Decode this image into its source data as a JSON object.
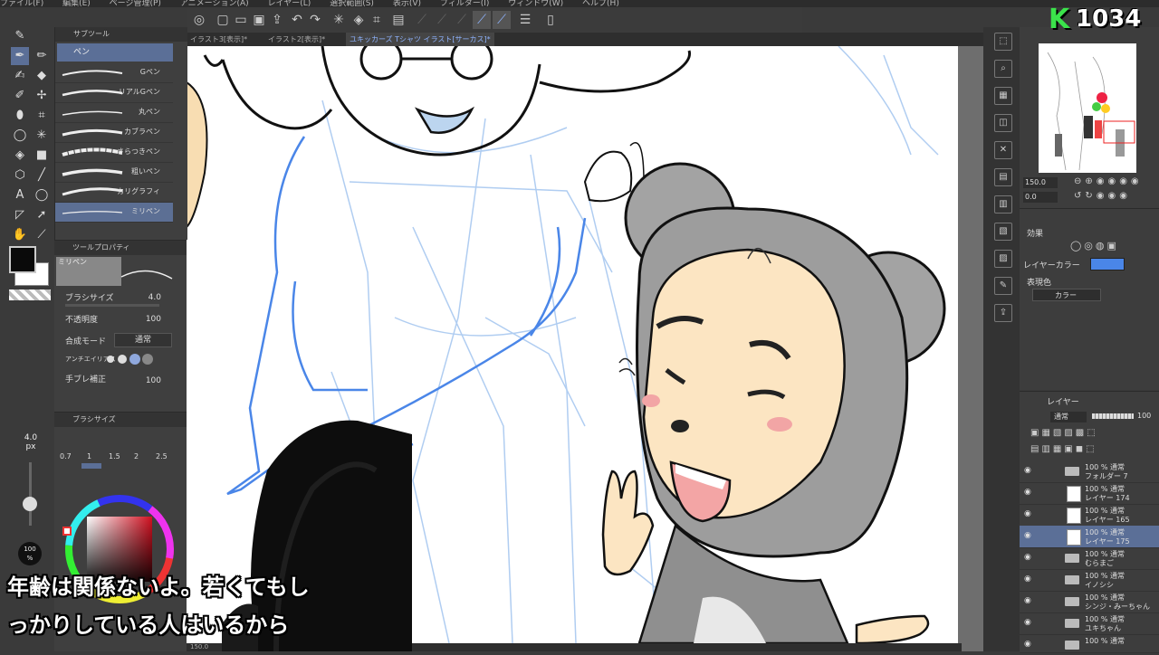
{
  "menubar": {
    "items": [
      "ファイル(F)",
      "編集(E)",
      "ページ管理(P)",
      "アニメーション(A)",
      "レイヤー(L)",
      "選択範囲(S)",
      "表示(V)",
      "フィルター(I)",
      "ウィンドウ(W)",
      "ヘルプ(H)"
    ]
  },
  "tabs": [
    {
      "label": "イラスト3[表示]*"
    },
    {
      "label": "イラスト2[表示]*"
    },
    {
      "label": "ユキッカーズ Tシャツ イラスト[サーカス]*"
    }
  ],
  "subtool": {
    "title": "サブツール",
    "group": "ペン",
    "brushes": [
      "Gペン",
      "リアルGペン",
      "丸ペン",
      "カブラペン",
      "さらつきペン",
      "粗いペン",
      "カリグラフィ",
      "ミリペン"
    ]
  },
  "toolprop": {
    "title": "ツールプロパティ",
    "preview_label": "ミリペン",
    "brush_size_label": "ブラシサイズ",
    "brush_size_value": "4.0",
    "opacity_label": "不透明度",
    "opacity_value": "100",
    "blend_label": "合成モード",
    "blend_value": "通常",
    "antialias_label": "アンチエイリアス",
    "stabilize_label": "手ブレ補正",
    "stabilize_value": "100"
  },
  "brushsize": {
    "title": "ブラシサイズ",
    "values": [
      "0.7",
      "1",
      "1.5",
      "2",
      "2.5"
    ]
  },
  "leftstrip": {
    "size_value": "4.0",
    "size_unit": "px",
    "opacity_value": "100",
    "opacity_unit": "%"
  },
  "ruler": {
    "value": "150.0"
  },
  "navigator": {
    "zoom": "150.0",
    "rotate": "0.0"
  },
  "effect": {
    "title": "効果",
    "layer_color_label": "レイヤーカラー",
    "expression_label": "表現色",
    "expression_value": "カラー"
  },
  "layers": {
    "title": "レイヤー",
    "blend": "通常",
    "opacity": "100",
    "items": [
      {
        "l1": "100 % 通常",
        "l2": "フォルダー 7",
        "type": "folder"
      },
      {
        "l1": "100 % 通常",
        "l2": "レイヤー 174",
        "type": "layer"
      },
      {
        "l1": "100 % 通常",
        "l2": "レイヤー 165",
        "type": "layer"
      },
      {
        "l1": "100 % 通常",
        "l2": "レイヤー 175",
        "type": "layer",
        "selected": true
      },
      {
        "l1": "100 % 通常",
        "l2": "むらまご",
        "type": "folder"
      },
      {
        "l1": "100 % 通常",
        "l2": "イノシシ",
        "type": "folder"
      },
      {
        "l1": "100 % 通常",
        "l2": "シンジ・みーちゃん",
        "type": "folder"
      },
      {
        "l1": "100 % 通常",
        "l2": "ユキちゃん",
        "type": "folder"
      },
      {
        "l1": "100 % 通常",
        "l2": "",
        "type": "folder"
      }
    ]
  },
  "overlay": {
    "logo_letter": "K",
    "logo_number": "1034",
    "subtitle_line1": "年齢は関係ないよ。若くてもし",
    "subtitle_line2": "っかりしている人はいるから"
  },
  "colors": {
    "accent": "#5b6f97",
    "layer_color": "#4a86e8",
    "logo_green": "#3be34b",
    "sketch_blue": "#4a86e8"
  }
}
